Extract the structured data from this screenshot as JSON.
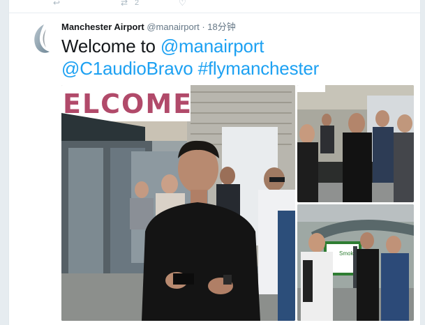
{
  "previous_tweet": {
    "actions": [
      {
        "icon": "reply-icon"
      },
      {
        "icon": "retweet-icon",
        "count": "2"
      },
      {
        "icon": "like-icon"
      }
    ]
  },
  "tweet": {
    "author_name": "Manchester Airport",
    "author_handle": "@manairport",
    "separator": "·",
    "timestamp": "18分钟",
    "text_plain": "Welcome to ",
    "mention1": "@manairport",
    "mention2": "@C1audioBravo",
    "hashtag": "#flymanchester",
    "link_color": "#1da1f2",
    "media": {
      "main_photo": {
        "sign_text": "ELCOME"
      },
      "photo_top_right": {},
      "photo_bottom_right": {
        "sign_text": "Smoking area"
      }
    }
  }
}
